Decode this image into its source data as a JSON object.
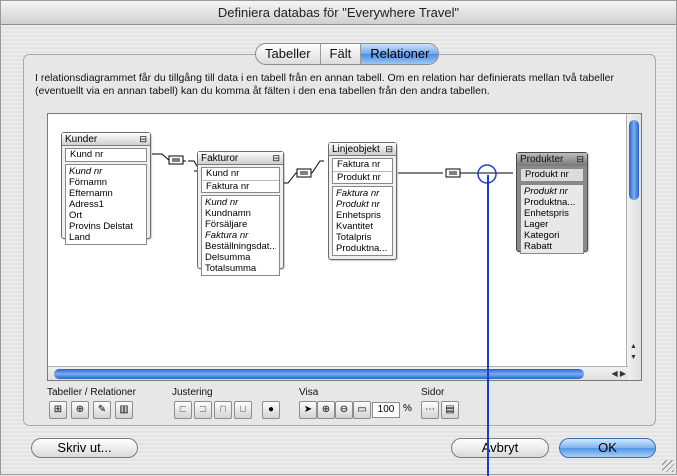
{
  "window": {
    "title": "Definiera databas för \"Everywhere Travel\""
  },
  "tabs": [
    {
      "label": "Tabeller",
      "active": false
    },
    {
      "label": "Fält",
      "active": false
    },
    {
      "label": "Relationer",
      "active": true
    }
  ],
  "description": "I relationsdiagrammet får du tillgång till data i en tabell från en annan tabell. Om en relation har definierats mellan två tabeller (eventuellt via en annan tabell) kan du komma åt fälten i den ena tabellen från den andra tabellen.",
  "tables": [
    {
      "name": "Kunder",
      "keys": [
        "Kund nr"
      ],
      "fields": [
        [
          "Kund nr",
          true
        ],
        [
          "Förnamn",
          false
        ],
        [
          "Efternamn",
          false
        ],
        [
          "Adress1",
          false
        ],
        [
          "Ort",
          false
        ],
        [
          "Provins Delstat",
          false
        ],
        [
          "Land",
          false
        ]
      ]
    },
    {
      "name": "Fakturor",
      "keys": [
        "Kund nr",
        "Faktura nr"
      ],
      "fields": [
        [
          "Kund nr",
          true
        ],
        [
          "Kundnamn",
          false
        ],
        [
          "Försäljare",
          false
        ],
        [
          "Faktura nr",
          true
        ],
        [
          "Beställningsdat...",
          false
        ],
        [
          "Delsumma",
          false
        ],
        [
          "Totalsumma",
          false
        ]
      ]
    },
    {
      "name": "Linjeobjekt",
      "keys": [
        "Faktura nr",
        "Produkt nr"
      ],
      "fields": [
        [
          "Faktura nr",
          true
        ],
        [
          "Produkt nr",
          true
        ],
        [
          "Enhetspris",
          false
        ],
        [
          "Kvantitet",
          false
        ],
        [
          "Totalpris",
          false
        ],
        [
          "Produktna...",
          false
        ]
      ]
    },
    {
      "name": "Produkter",
      "keys": [
        "Produkt nr"
      ],
      "fields": [
        [
          "Produkt nr",
          true
        ],
        [
          "Produktna...",
          false
        ],
        [
          "Enhetspris",
          false
        ],
        [
          "Lager",
          false
        ],
        [
          "Kategori",
          false
        ],
        [
          "Rabatt",
          false
        ]
      ]
    }
  ],
  "toolbar": {
    "groups": [
      "Tabeller / Relationer",
      "Justering",
      "Visa",
      "Sidor"
    ],
    "zoom": "100",
    "zoom_unit": "%"
  },
  "buttons": {
    "print": "Skriv ut...",
    "cancel": "Avbryt",
    "ok": "OK"
  },
  "colors": {
    "accent": "#4b8ee3",
    "relation_highlight": "#1d3fc7"
  }
}
